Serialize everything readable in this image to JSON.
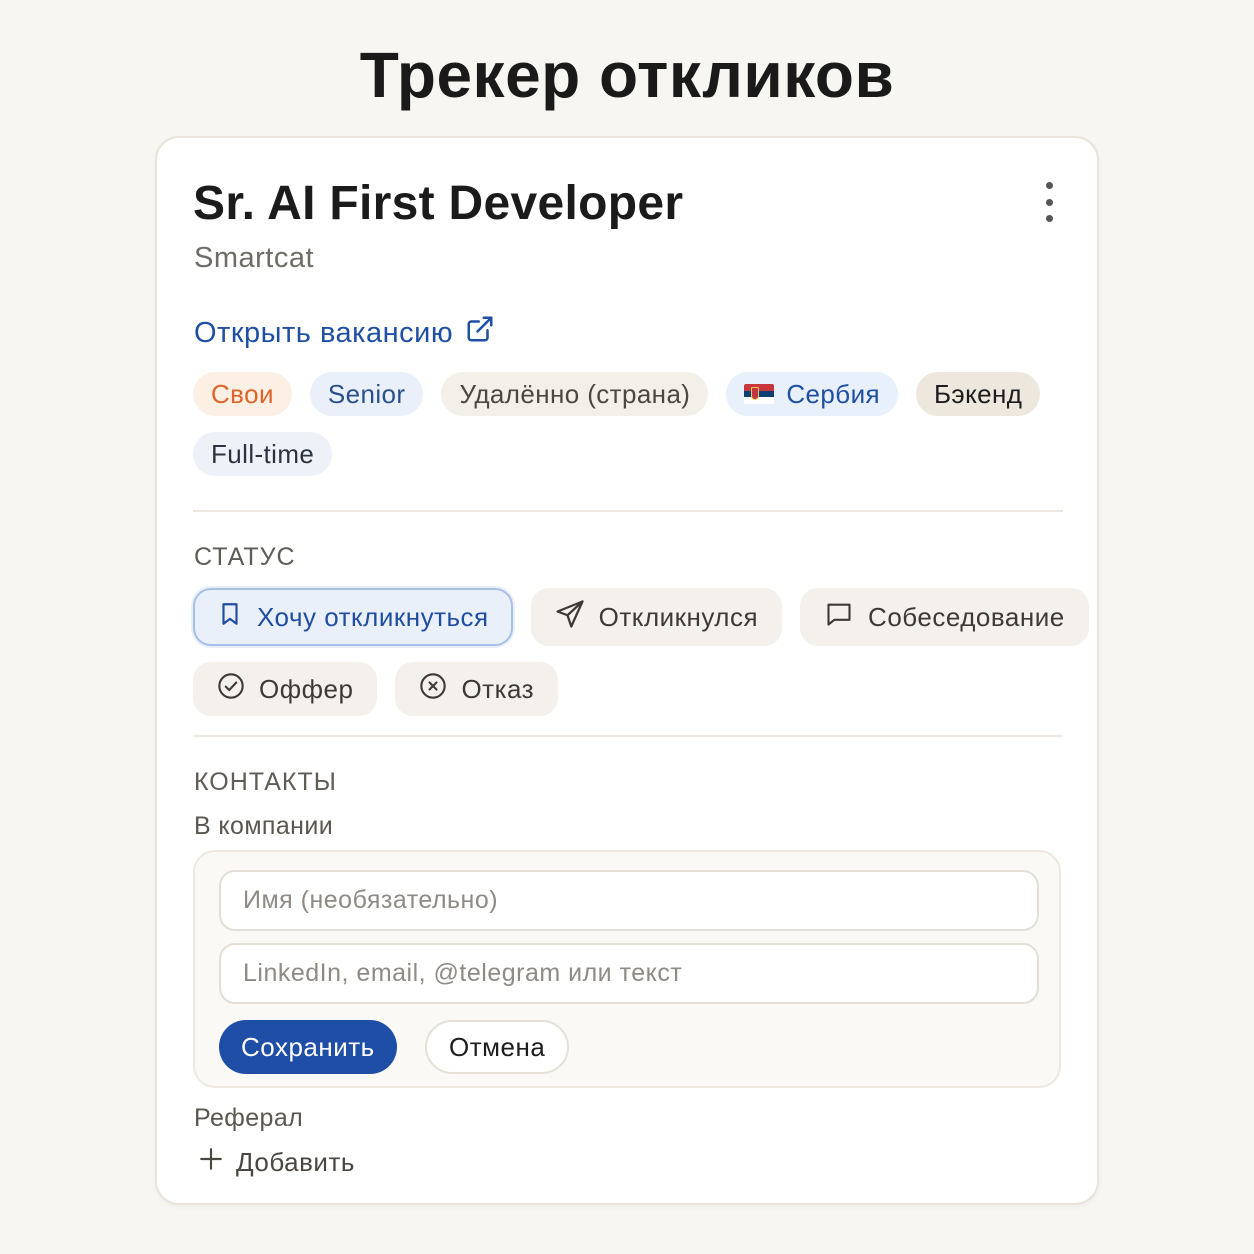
{
  "page_title": "Трекер откликов",
  "job": {
    "title": "Sr. AI First Developer",
    "company": "Smartcat",
    "open_link": "Открыть вакансию"
  },
  "tags": [
    {
      "label": "Свои",
      "color": "#e0642a"
    },
    {
      "label": "Senior",
      "color": "#2a4f8a"
    },
    {
      "label": "Удалённо (страна)",
      "color": "#4c4740"
    },
    {
      "label": "Сербия",
      "flag": "serbia-flag",
      "color": "#1f4fa3"
    },
    {
      "label": "Бэкенд",
      "color": "#1d1d1f"
    },
    {
      "label": "Full-time",
      "color": "#2b3340"
    }
  ],
  "status": {
    "section_label": "СТАТУС",
    "options": [
      {
        "label": "Хочу откликнуться",
        "icon": "bookmark-icon",
        "active": true
      },
      {
        "label": "Откликнулся",
        "icon": "send-icon",
        "active": false
      },
      {
        "label": "Собеседование",
        "icon": "chat-icon",
        "active": false
      },
      {
        "label": "Оффер",
        "icon": "check-circle-icon",
        "active": false
      },
      {
        "label": "Отказ",
        "icon": "x-circle-icon",
        "active": false
      }
    ]
  },
  "contacts": {
    "section_label": "КОНТАКТЫ",
    "company_label": "В компании",
    "name_placeholder": "Имя (необязательно)",
    "contact_placeholder": "LinkedIn, email, @telegram или текст",
    "save_label": "Сохранить",
    "cancel_label": "Отмена",
    "referral_label": "Реферал",
    "add_label": "Добавить"
  },
  "colors": {
    "accent": "#1f4ea6",
    "background": "#f8f6f2",
    "link": "#1f4fa3"
  }
}
